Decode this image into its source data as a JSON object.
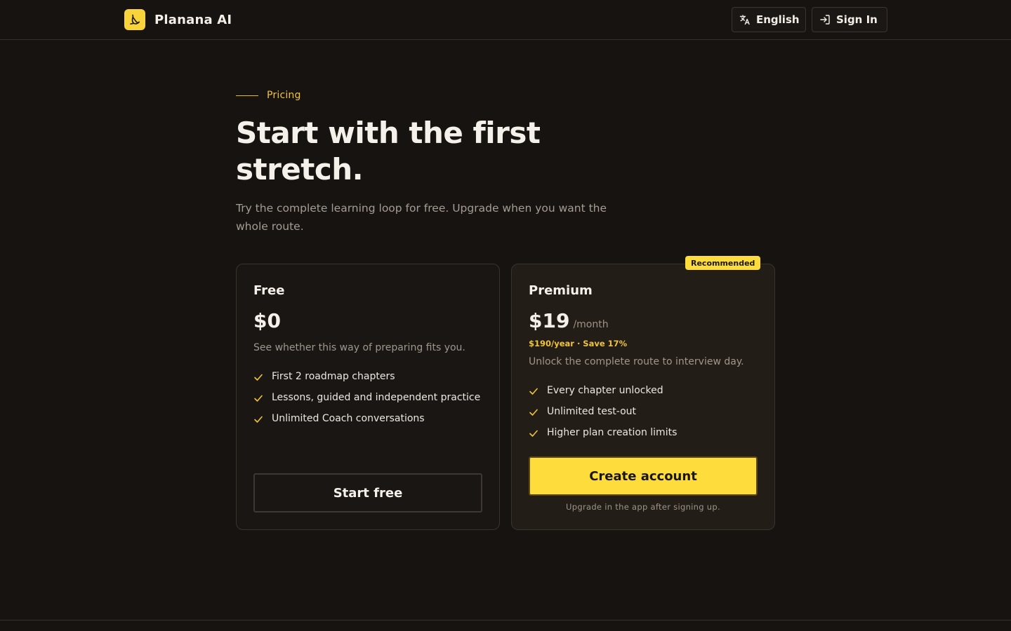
{
  "header": {
    "brand_name": "Planana AI",
    "language_label": "English",
    "signin_label": "Sign In"
  },
  "hero": {
    "eyebrow": "Pricing",
    "title": "Start with the first stretch.",
    "subtitle": "Try the complete learning loop for free. Upgrade when you want the whole route."
  },
  "plans": {
    "free": {
      "name": "Free",
      "price": "$0",
      "description": "See whether this way of preparing fits you.",
      "features": [
        "First 2 roadmap chapters",
        "Lessons, guided and independent practice",
        "Unlimited Coach conversations"
      ],
      "cta": "Start free"
    },
    "premium": {
      "badge": "Recommended",
      "name": "Premium",
      "price": "$19",
      "period": "/month",
      "annual": "$190/year · Save 17%",
      "description": "Unlock the complete route to interview day.",
      "features": [
        "Every chapter unlocked",
        "Unlimited test-out",
        "Higher plan creation limits"
      ],
      "cta": "Create account",
      "note": "Upgrade in the app after signing up."
    }
  },
  "colors": {
    "background": "#171311",
    "accent": "#fddc3c",
    "accent_text": "#f0c33c",
    "muted_text": "#a59d93"
  },
  "icons": {
    "brand": "banana-icon",
    "language": "translate-icon",
    "signin": "sign-in-icon",
    "feature": "check-icon"
  }
}
